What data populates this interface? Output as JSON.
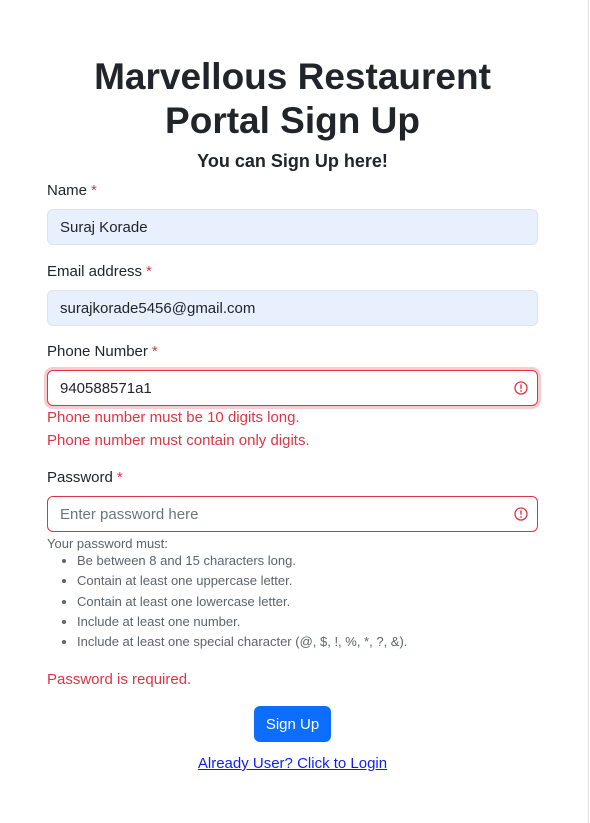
{
  "header": {
    "title": "Marvellous Restaurent Portal Sign Up",
    "subtitle": "You can Sign Up here!"
  },
  "form": {
    "required_marker": "*",
    "name": {
      "label": "Name",
      "value": "Suraj Korade"
    },
    "email": {
      "label": "Email address",
      "value": "surajkorade5456@gmail.com"
    },
    "phone": {
      "label": "Phone Number",
      "value": "940588571a1",
      "errors": [
        "Phone number must be 10 digits long.",
        "Phone number must contain only digits."
      ]
    },
    "password": {
      "label": "Password",
      "placeholder": "Enter password here",
      "help_title": "Your password must:",
      "rules": [
        "Be between 8 and 15 characters long.",
        "Contain at least one uppercase letter.",
        "Contain at least one lowercase letter.",
        "Include at least one number.",
        "Include at least one special character (@, $, !, %, *, ?, &)."
      ],
      "error": "Password is required."
    },
    "submit_label": "Sign Up",
    "login_link": "Already User? Click to Login"
  },
  "colors": {
    "primary": "#0d6efd",
    "danger": "#dc3545",
    "autofill_bg": "#e8f0fe"
  },
  "icons": {
    "invalid": "exclamation-circle-icon"
  }
}
